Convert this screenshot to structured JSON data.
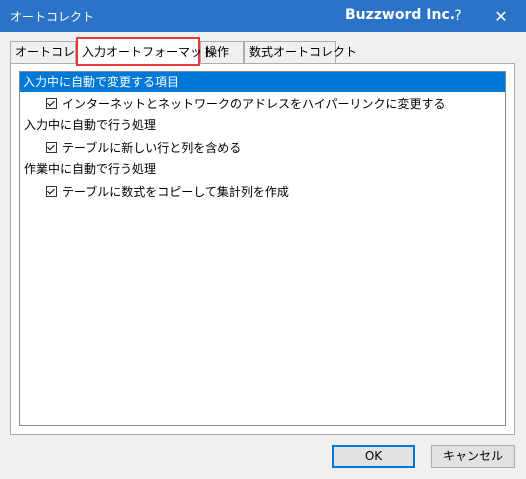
{
  "window": {
    "title": "オートコレクト",
    "brand": "Buzzword Inc.",
    "help_label": "?",
    "close_label": "✕"
  },
  "tabs": [
    {
      "label": "オートコレクト"
    },
    {
      "label": "入力オートフォーマット",
      "active": true
    },
    {
      "label": "操作"
    },
    {
      "label": "数式オートコレクト"
    }
  ],
  "list": {
    "selected_header": "入力中に自動で変更する項目",
    "option1": "インターネットとネットワークのアドレスをハイパーリンクに変更する",
    "group2": "入力中に自動で行う処理",
    "option2": "テーブルに新しい行と列を含める",
    "group3": "作業中に自動で行う処理",
    "option3": "テーブルに数式をコピーして集計列を作成"
  },
  "buttons": {
    "ok": "OK",
    "cancel": "キャンセル"
  },
  "colors": {
    "titlebar": "#2b73c7",
    "selection": "#0078d7",
    "highlight_box": "#e53935"
  }
}
